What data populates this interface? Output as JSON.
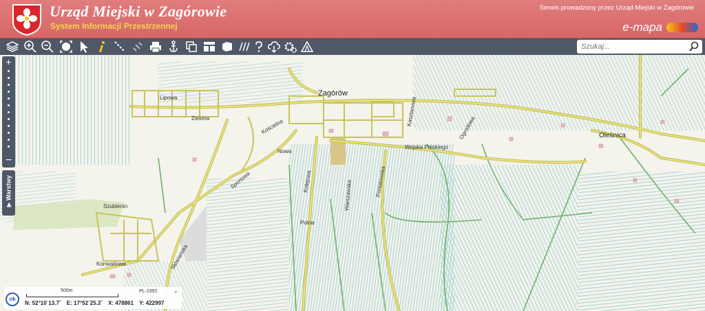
{
  "header": {
    "title": "Urząd Miejski w Zagórowie",
    "subtitle": "System Informacji Przestrzennej",
    "service_note": "Serwis prowadzony przez Urząd Miejski w Zagórowie",
    "brand": "e-mapa"
  },
  "toolbar": {
    "tools": [
      {
        "icon": "layers-icon"
      },
      {
        "icon": "zoom-in-icon"
      },
      {
        "icon": "zoom-out-icon"
      },
      {
        "icon": "full-extent-icon"
      },
      {
        "icon": "pointer-icon"
      },
      {
        "icon": "info-icon"
      },
      {
        "icon": "measure-icon"
      },
      {
        "icon": "link-icon"
      },
      {
        "icon": "print-icon"
      },
      {
        "icon": "anchor-icon"
      },
      {
        "icon": "copy-icon"
      },
      {
        "icon": "layout-icon"
      },
      {
        "icon": "area-icon"
      },
      {
        "icon": "hatch-icon"
      },
      {
        "icon": "help-icon"
      },
      {
        "icon": "cloud-download-icon"
      },
      {
        "icon": "settings-icon"
      },
      {
        "icon": "terrain-icon"
      }
    ],
    "search_placeholder": "Szukaj..."
  },
  "map": {
    "labels": {
      "zagorow": "Zagórów",
      "oleśnica": "Oleśnica",
      "szubienin": "Szubienin",
      "poniatowska": "Poniatowska",
      "sportowa": "Sportowa",
      "kolejowa": "Kolejowa",
      "warszawska": "Warszawska",
      "wojska_polskiego": "Wojska Polskiego",
      "nowa": "Nowa",
      "polna": "Polna",
      "kasztanowa": "Kasztanowa",
      "ogrodowa": "Ogrodowa",
      "lipowa": "Lipowa",
      "zielona": "Zielona",
      "slowianska": "Słowiańska",
      "koscielna": "Kościelna",
      "konwaliowa": "Konwaliowa"
    },
    "layers_tab": "Warstwy"
  },
  "info_panel": {
    "scale": "500m",
    "projection": "PL-1992",
    "ok_label": "ok",
    "lat": "N: 52°10´13.7˝",
    "lon": "E: 17°52´25.3˝",
    "x": "X: 478861",
    "y": "Y: 422997"
  },
  "colors": {
    "header": "#d76666",
    "toolbar": "#4e5866",
    "road": "#e9e07a",
    "road_edge": "#b7b54a",
    "water": "#7fc6c8",
    "field_line": "#8cc9cc",
    "green_road": "#6db26a"
  }
}
